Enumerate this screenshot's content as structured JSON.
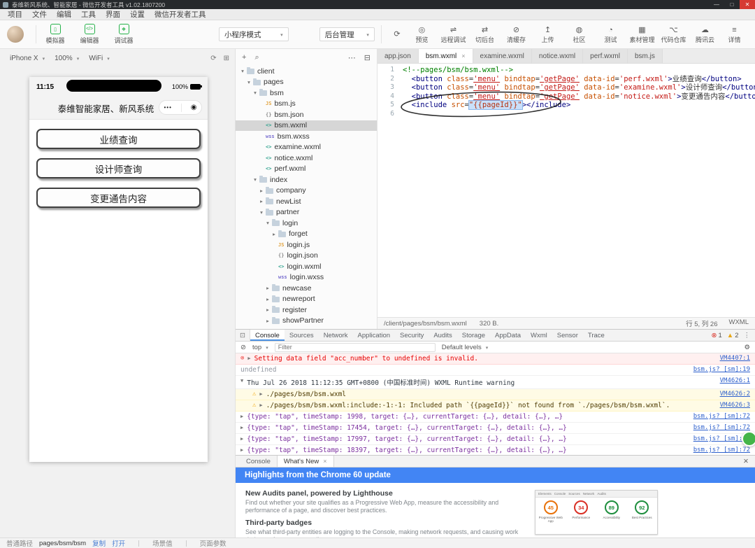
{
  "window": {
    "title": "泰维新风系统、智能家居 - 微信开发者工具 v1.02.1807200",
    "controls": {
      "minimize": "—",
      "maximize": "□",
      "close": "✕"
    }
  },
  "menu": {
    "items": [
      "项目",
      "文件",
      "编辑",
      "工具",
      "界面",
      "设置",
      "微信开发者工具"
    ]
  },
  "toolbar": {
    "views": [
      {
        "name": "simulator",
        "glyph": "▯",
        "label": "模拟器"
      },
      {
        "name": "editor",
        "glyph": "</>",
        "label": "编辑器"
      },
      {
        "name": "debugger",
        "glyph": "❖",
        "label": "调试器"
      }
    ],
    "mode": "小程序模式",
    "env": "后台管理",
    "compile_glyph": "⟳",
    "actions": [
      {
        "name": "preview",
        "glyph": "◎",
        "label": "预览"
      },
      {
        "name": "remote-debug",
        "glyph": "⇌",
        "label": "远程调试"
      },
      {
        "name": "switch-background",
        "glyph": "⇄",
        "label": "切后台"
      },
      {
        "name": "clear-cache",
        "glyph": "⊘",
        "label": "清缓存"
      },
      {
        "name": "upload",
        "glyph": "↥",
        "label": "上传"
      },
      {
        "name": "community",
        "glyph": "◍",
        "label": "社区"
      },
      {
        "name": "test",
        "glyph": "◔",
        "label": "测试"
      },
      {
        "name": "assets",
        "glyph": "▦",
        "label": "素材管理"
      },
      {
        "name": "repository",
        "glyph": "⌥",
        "label": "代码仓库"
      },
      {
        "name": "tencent-cloud",
        "glyph": "☁",
        "label": "腾讯云"
      }
    ],
    "details": {
      "glyph": "≡",
      "label": "详情"
    }
  },
  "simulator": {
    "device": "iPhone X",
    "zoom": "100%",
    "network": "WiFi",
    "icons": {
      "rotate": "⟳",
      "layout": "⊞"
    },
    "phone": {
      "time": "11:15",
      "battery": "100%",
      "nav_title": "泰维智能家居、新风系统",
      "capsule": {
        "more": "•••",
        "home": "◉"
      },
      "buttons": [
        "业绩查询",
        "设计师查询",
        "变更通告内容"
      ]
    }
  },
  "file_tree": {
    "toolbar": {
      "add": "+",
      "search": "⌕",
      "more": "⋯",
      "collapse": "⊟"
    },
    "items": [
      {
        "n": "client",
        "t": "dir",
        "l": 0,
        "open": true
      },
      {
        "n": "pages",
        "t": "dir",
        "l": 1,
        "open": true
      },
      {
        "n": "bsm",
        "t": "dir",
        "l": 2,
        "open": true
      },
      {
        "n": "bsm.js",
        "t": "js",
        "l": 3
      },
      {
        "n": "bsm.json",
        "t": "json",
        "l": 3
      },
      {
        "n": "bsm.wxml",
        "t": "wxml",
        "l": 3,
        "sel": true
      },
      {
        "n": "bsm.wxss",
        "t": "wxss",
        "l": 3
      },
      {
        "n": "examine.wxml",
        "t": "wxml",
        "l": 3
      },
      {
        "n": "notice.wxml",
        "t": "wxml",
        "l": 3
      },
      {
        "n": "perf.wxml",
        "t": "wxml",
        "l": 3
      },
      {
        "n": "index",
        "t": "dir",
        "l": 2,
        "open": true
      },
      {
        "n": "company",
        "t": "dir",
        "l": 3
      },
      {
        "n": "newList",
        "t": "dir",
        "l": 3
      },
      {
        "n": "partner",
        "t": "dir",
        "l": 3,
        "open": true
      },
      {
        "n": "login",
        "t": "dir",
        "l": 4,
        "open": true
      },
      {
        "n": "forget",
        "t": "dir",
        "l": 5
      },
      {
        "n": "login.js",
        "t": "js",
        "l": 5
      },
      {
        "n": "login.json",
        "t": "json",
        "l": 5
      },
      {
        "n": "login.wxml",
        "t": "wxml",
        "l": 5
      },
      {
        "n": "login.wxss",
        "t": "wxss",
        "l": 5
      },
      {
        "n": "newcase",
        "t": "dir",
        "l": 4
      },
      {
        "n": "newreport",
        "t": "dir",
        "l": 4
      },
      {
        "n": "register",
        "t": "dir",
        "l": 4
      },
      {
        "n": "showPartner",
        "t": "dir",
        "l": 4
      }
    ]
  },
  "editor": {
    "tabs": [
      {
        "label": "app.json"
      },
      {
        "label": "bsm.wxml",
        "active": true,
        "close": "×"
      },
      {
        "label": "examine.wxml"
      },
      {
        "label": "notice.wxml"
      },
      {
        "label": "perf.wxml"
      },
      {
        "label": "bsm.js"
      }
    ],
    "lines": [
      [
        [
          "cm",
          "<!--pages/bsm/bsm.wxml-->"
        ]
      ],
      [
        [
          "pl",
          "  "
        ],
        [
          "tg",
          "<button"
        ],
        [
          "pl",
          " "
        ],
        [
          "at",
          "class"
        ],
        [
          "eq",
          "="
        ],
        [
          "stu",
          "'menu'"
        ],
        [
          "pl",
          " "
        ],
        [
          "at",
          "bindtap"
        ],
        [
          "eq",
          "="
        ],
        [
          "stu",
          "'getPage'"
        ],
        [
          "pl",
          " "
        ],
        [
          "at",
          "data-id"
        ],
        [
          "eq",
          "="
        ],
        [
          "st",
          "'perf.wxml'"
        ],
        [
          "tg",
          ">"
        ],
        [
          "tx",
          "业绩查询"
        ],
        [
          "tg",
          "</button>"
        ]
      ],
      [
        [
          "pl",
          "  "
        ],
        [
          "tg",
          "<button"
        ],
        [
          "pl",
          " "
        ],
        [
          "at",
          "class"
        ],
        [
          "eq",
          "="
        ],
        [
          "stu",
          "'menu'"
        ],
        [
          "pl",
          " "
        ],
        [
          "at",
          "bindtap"
        ],
        [
          "eq",
          "="
        ],
        [
          "stu",
          "'getPage'"
        ],
        [
          "pl",
          " "
        ],
        [
          "at",
          "data-id"
        ],
        [
          "eq",
          "="
        ],
        [
          "st",
          "'examine.wxml'"
        ],
        [
          "tg",
          ">"
        ],
        [
          "tx",
          "设计师查询"
        ],
        [
          "tg",
          "</button>"
        ]
      ],
      [
        [
          "pl",
          "  "
        ],
        [
          "tg",
          "<button"
        ],
        [
          "pl",
          " "
        ],
        [
          "at",
          "class"
        ],
        [
          "eq",
          "="
        ],
        [
          "stu",
          "'menu'"
        ],
        [
          "pl",
          " "
        ],
        [
          "at",
          "bindtap"
        ],
        [
          "eq",
          "="
        ],
        [
          "stu",
          "'getPage'"
        ],
        [
          "pl",
          " "
        ],
        [
          "at",
          "data-id"
        ],
        [
          "eq",
          "="
        ],
        [
          "st",
          "'notice.wxml'"
        ],
        [
          "tg",
          ">"
        ],
        [
          "tx",
          "变更通告内容"
        ],
        [
          "tg",
          "</button>"
        ]
      ],
      [
        [
          "pl",
          "  "
        ],
        [
          "tg",
          "<include"
        ],
        [
          "pl",
          " "
        ],
        [
          "at",
          "src"
        ],
        [
          "eq",
          "="
        ],
        [
          "sel",
          "\"{{pageId}}\""
        ],
        [
          "tg",
          ">"
        ],
        [
          "tg",
          "</include>"
        ]
      ],
      []
    ],
    "status": {
      "path": "/client/pages/bsm/bsm.wxml",
      "size": "320 B.",
      "cursor": "行 5, 列 26",
      "lang": "WXML"
    }
  },
  "devtools": {
    "tabs": [
      "Console",
      "Sources",
      "Network",
      "Application",
      "Security",
      "Audits",
      "Storage",
      "AppData",
      "Wxml",
      "Sensor",
      "Trace"
    ],
    "active": "Console",
    "error_count": "1",
    "warning_count": "2",
    "icons": {
      "inspect": "⊡",
      "menu": "⋮",
      "gear": "⚙",
      "clear": "⊘",
      "error": "⊗",
      "warning": "▲"
    },
    "filter": {
      "context": "top",
      "placeholder": "Filter",
      "levels": "Default levels"
    },
    "messages": [
      {
        "lv": "error",
        "ic": "⊗",
        "ar": "▶",
        "t": "Setting data field \"acc_number\" to undefined is invalid.",
        "s": "VM4407:1"
      },
      {
        "lv": "muted",
        "ic": "",
        "ar": "",
        "t": "undefined",
        "s": "bsm.js? [sm]:19"
      },
      {
        "lv": "log",
        "ic": "",
        "ar": "▼",
        "t": "Thu Jul 26 2018 11:12:35 GMT+0800 (中国标准时间) WXML Runtime warning",
        "s": "VM4626:1"
      },
      {
        "lv": "warn",
        "ic": "⚠",
        "ar": "▶",
        "t": "./pages/bsm/bsm.wxml",
        "s": "VM4626:2",
        "ind": true
      },
      {
        "lv": "warn",
        "ic": "⚠",
        "ar": "▶",
        "t": "./pages/bsm/bsm.wxml:include:-1:-1: Included path `{{pageId}}` not found from `./pages/bsm/bsm.wxml`.",
        "s": "VM4626:3",
        "ind": true
      },
      {
        "lv": "obj",
        "ic": "",
        "ar": "▶",
        "t": "{type: \"tap\", timeStamp: 1998, target: {…}, currentTarget: {…}, detail: {…}, …}",
        "s": "bsm.js? [sm]:72"
      },
      {
        "lv": "obj",
        "ic": "",
        "ar": "▶",
        "t": "{type: \"tap\", timeStamp: 17454, target: {…}, currentTarget: {…}, detail: {…}, …}",
        "s": "bsm.js? [sm]:72"
      },
      {
        "lv": "obj",
        "ic": "",
        "ar": "▶",
        "t": "{type: \"tap\", timeStamp: 17997, target: {…}, currentTarget: {…}, detail: {…}, …}",
        "s": "bsm.js? [sm]:72"
      },
      {
        "lv": "obj",
        "ic": "",
        "ar": "▶",
        "t": "{type: \"tap\", timeStamp: 18397, target: {…}, currentTarget: {…}, detail: {…}, …}",
        "s": "bsm.js? [sm]:72"
      }
    ]
  },
  "whatsnew": {
    "tabs": [
      {
        "label": "Console"
      },
      {
        "label": "What's New",
        "active": true,
        "close": "×"
      }
    ],
    "close_glyph": "✕",
    "banner": "Highlights from the Chrome 60 update",
    "sections": [
      {
        "title": "New Audits panel, powered by Lighthouse",
        "body": "Find out whether your site qualifies as a Progressive Web App, measure the accessibility and performance of a page, and discover best practices."
      },
      {
        "title": "Third-party badges",
        "body": "See what third-party entities are logging to the Console, making network requests, and causing work during performance recordings."
      }
    ],
    "thumb": {
      "tabs": [
        "Elements",
        "Console",
        "Sources",
        "Network",
        "Audits"
      ],
      "scores": [
        {
          "value": "45",
          "label": "Progressive Web App",
          "color": "#e8710a"
        },
        {
          "value": "34",
          "label": "Performance",
          "color": "#d93025"
        },
        {
          "value": "89",
          "label": "Accessibility",
          "color": "#1e8e3e"
        },
        {
          "value": "92",
          "label": "Best Practices",
          "color": "#1e8e3e"
        }
      ]
    }
  },
  "statusbar": {
    "path_label": "普通路径",
    "path_value": "pages/bsm/bsm",
    "copy_label": "复制",
    "open_label": "打开",
    "scene_label": "场景值",
    "params_label": "页面参数"
  }
}
